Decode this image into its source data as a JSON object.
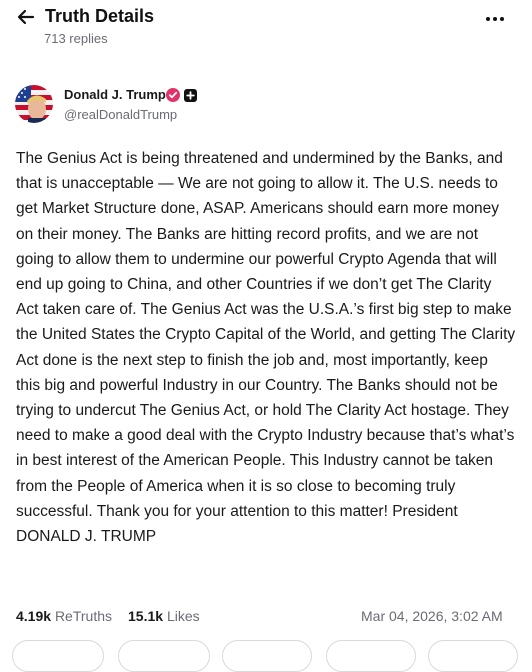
{
  "header": {
    "title": "Truth Details",
    "replies": "713 replies",
    "back_icon": "arrow-left-icon",
    "more_icon": "more-horizontal-icon"
  },
  "author": {
    "name": "Donald J. Trump",
    "handle": "@realDonaldTrump",
    "verified_icon": "verified-badge-icon",
    "verified_color": "#e2326a",
    "extra_badge_icon": "plus-square-icon"
  },
  "post": {
    "text": "The Genius Act is being threatened and undermined by the Banks, and that is unacceptable — We are not going to allow it. The U.S. needs to get Market Structure done, ASAP. Americans should earn more money on their money. The Banks are hitting record profits, and we are not going to allow them to undermine our powerful Crypto Agenda that will end up going to China, and other Countries if we don’t get The Clarity Act taken care of. The Genius Act was the U.S.A.’s first big step to make the United States the Crypto Capital of the World, and getting The Clarity Act done is the next step to finish the job and, most importantly, keep this big and powerful Industry in our Country. The Banks should not be trying to undercut The Genius Act, or hold The Clarity Act hostage. They need to make a good deal with the Crypto Industry because that’s what’s in best interest of the American People. This Industry cannot be taken from the People of America when it is so close to becoming truly successful. Thank you for your attention to this matter! President DONALD J. TRUMP"
  },
  "stats": {
    "retruths_count": "4.19k",
    "retruths_label": "ReTruths",
    "likes_count": "15.1k",
    "likes_label": "Likes",
    "timestamp": "Mar 04, 2026, 3:02 AM"
  },
  "colors": {
    "text": "#1a1a1a",
    "muted": "#6b6b76",
    "border": "#d9d9de"
  }
}
